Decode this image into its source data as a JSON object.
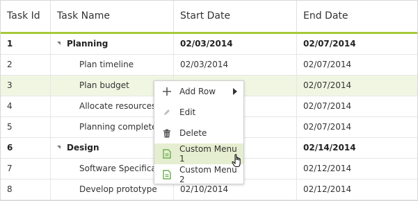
{
  "columns": [
    "Task Id",
    "Task Name",
    "Start Date",
    "End Date"
  ],
  "rows": [
    {
      "id": "1",
      "name": "Planning",
      "start": "02/03/2014",
      "end": "02/07/2014",
      "parent": true
    },
    {
      "id": "2",
      "name": "Plan timeline",
      "start": "02/03/2014",
      "end": "02/07/2014",
      "parent": false
    },
    {
      "id": "3",
      "name": "Plan budget",
      "start": "",
      "end": "02/07/2014",
      "parent": false
    },
    {
      "id": "4",
      "name": "Allocate resources",
      "start": "",
      "end": "02/07/2014",
      "parent": false
    },
    {
      "id": "5",
      "name": "Planning complete",
      "start": "",
      "end": "02/07/2014",
      "parent": false
    },
    {
      "id": "6",
      "name": "Design",
      "start": "",
      "end": "02/14/2014",
      "parent": true
    },
    {
      "id": "7",
      "name": "Software Specification",
      "start": "",
      "end": "02/12/2014",
      "parent": false
    },
    {
      "id": "8",
      "name": "Develop prototype",
      "start": "02/10/2014",
      "end": "02/12/2014",
      "parent": false
    }
  ],
  "context_menu": {
    "items": [
      {
        "label": "Add Row",
        "icon": "plus-icon"
      },
      {
        "label": "Edit",
        "icon": "pencil-icon"
      },
      {
        "label": "Delete",
        "icon": "trash-icon"
      },
      {
        "label": "Custom Menu 1",
        "icon": "document-icon"
      },
      {
        "label": "Custom Menu 2",
        "icon": "document-icon"
      }
    ]
  },
  "colors": {
    "accent": "#a6c93a",
    "selected_row": "#f1f6e3",
    "menu_hover": "#e5eed0",
    "doc_icon": "#6ab04c"
  }
}
